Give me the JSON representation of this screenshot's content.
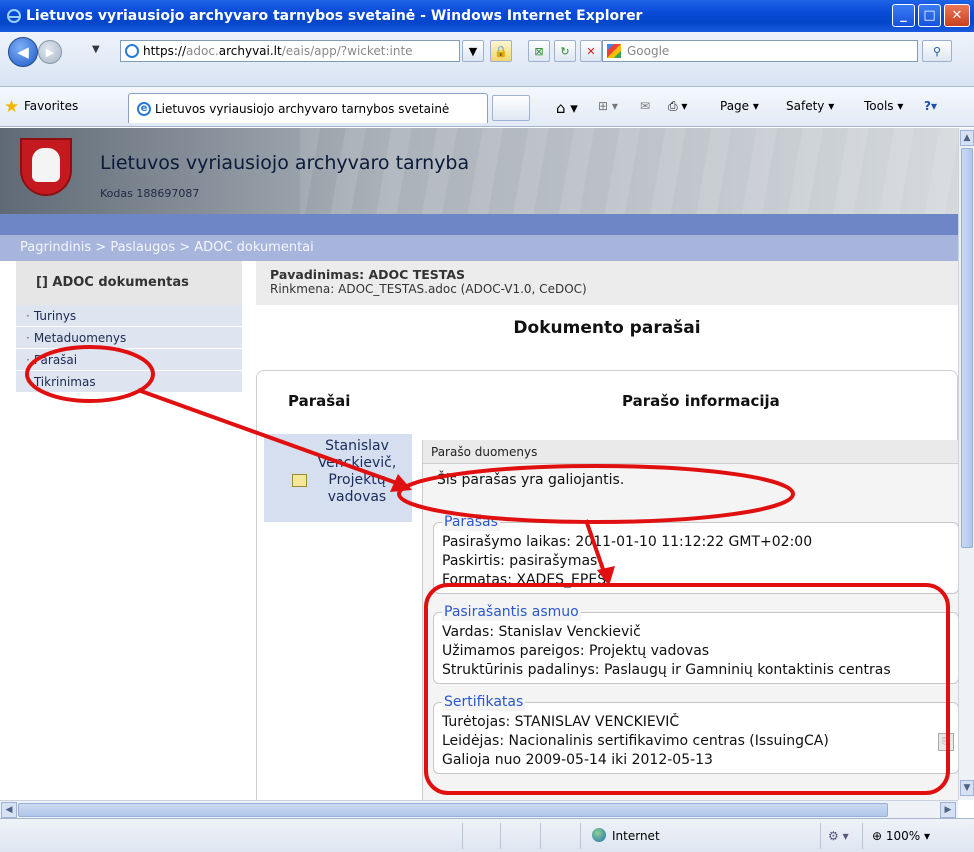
{
  "window": {
    "title": "Lietuvos vyriausiojo archyvaro tarnybos svetainė - Windows Internet Explorer"
  },
  "address": {
    "url_scheme": "https://",
    "url_sub": "adoc.",
    "url_domain": "archyvai.lt",
    "url_path": "/eais/app/?wicket:inte",
    "search_placeholder": "Google"
  },
  "favorites": {
    "label": "Favorites",
    "tab_title": "Lietuvos vyriausiojo archyvaro tarnybos svetainė"
  },
  "commands": {
    "page": "Page",
    "safety": "Safety",
    "tools": "Tools"
  },
  "site": {
    "title": "Lietuvos vyriausiojo archyvaro tarnyba",
    "code": "Kodas 188697087"
  },
  "breadcrumb": "Pagrindinis  >  Paslaugos  >  ADOC dokumentai",
  "sidebar": {
    "heading": "[]  ADOC dokumentas",
    "items": [
      {
        "label": "Turinys"
      },
      {
        "label": "Metaduomenys"
      },
      {
        "label": "Parašai"
      },
      {
        "label": "Tikrinimas"
      }
    ]
  },
  "doc": {
    "name": "Pavadinimas: ADOC TESTAS",
    "file": "Rinkmena: ADOC_TESTAS.adoc (ADOC-V1.0, CeDOC)"
  },
  "main": {
    "title": "Dokumento parašai",
    "col_sigs": "Parašai",
    "col_info": "Parašo informacija"
  },
  "signer": {
    "line1": "Stanislav",
    "line2": "Venckievič,",
    "line3": "Projektų",
    "line4": "vadovas"
  },
  "details": {
    "header": "Parašo duomenys",
    "validity": "Šis parašas yra galiojantis.",
    "signature": {
      "legend": "Parašas",
      "rows": [
        "Pasirašymo laikas: 2011-01-10 11:12:22 GMT+02:00",
        "Paskirtis: pasirašymas",
        "Formatas: XADES_EPES"
      ]
    },
    "person": {
      "legend": "Pasirašantis asmuo",
      "rows": [
        "Vardas: Stanislav Venckievič",
        "Užimamos pareigos: Projektų vadovas",
        "Struktūrinis padalinys: Paslaugų ir Gamninių kontaktinis centras"
      ]
    },
    "certificate": {
      "legend": "Sertifikatas",
      "rows": [
        "Turėtojas: STANISLAV VENCKIEVIČ",
        "Leidėjas: Nacionalinis sertifikavimo centras (IssuingCA)",
        "Galioja nuo 2009-05-14 iki 2012-05-13"
      ]
    }
  },
  "status": {
    "zone": "Internet",
    "zoom": "100%"
  },
  "colors": {
    "annotation": "#e01010",
    "link": "#2b57c9",
    "band": "#6f86c6"
  }
}
